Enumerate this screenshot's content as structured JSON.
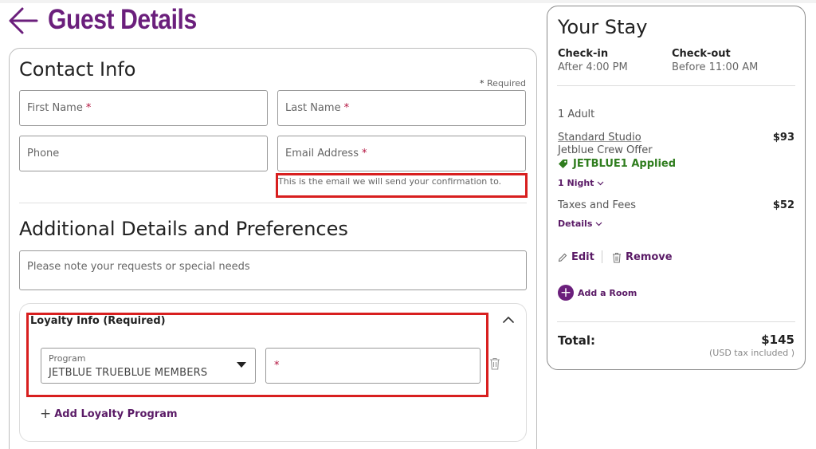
{
  "header": {
    "title": "Guest Details"
  },
  "contact": {
    "title": "Contact Info",
    "required_note": "Required",
    "required_star": "*",
    "first_name": "First Name",
    "last_name": "Last Name",
    "phone": "Phone",
    "email": "Email Address",
    "req_star": "*",
    "email_hint": "This is the email we will send your confirmation to."
  },
  "additional": {
    "title": "Additional Details and Preferences",
    "notes_placeholder": "Please note your requests or special needs"
  },
  "loyalty": {
    "title": "Loyalty Info (Required)",
    "program_label": "Program",
    "program_value": "JETBLUE TRUEBLUE MEMBERS",
    "member_star": "*",
    "add_label": "Add Loyalty Program",
    "add_plus": "+"
  },
  "stay": {
    "title": "Your Stay",
    "checkin_label": "Check-in",
    "checkin_value": "After 4:00 PM",
    "checkout_label": "Check-out",
    "checkout_value": "Before 11:00 AM",
    "guests": "1 Adult",
    "room_name": "Standard Studio",
    "room_offer": "Jetblue Crew Offer",
    "room_price": "$93",
    "promo": "JETBLUE1 Applied",
    "nights": "1 Night",
    "taxes_label": "Taxes and Fees",
    "taxes_price": "$52",
    "details": "Details",
    "edit": "Edit",
    "remove": "Remove",
    "add_room": "Add a Room",
    "add_room_plus": "+",
    "total_label": "Total:",
    "total_value": "$145",
    "tax_note": "(USD tax included )"
  },
  "colors": {
    "brand_purple": "#6b1f7c",
    "link_purple": "#5a1a66",
    "promo_green": "#2f7d1e",
    "highlight_red": "#d81f1f"
  },
  "icons": [
    "back-arrow-icon",
    "chevron-up-icon",
    "dropdown-caret-icon",
    "trash-icon",
    "tag-icon",
    "chevron-down-icon",
    "pencil-icon",
    "plus-icon"
  ]
}
